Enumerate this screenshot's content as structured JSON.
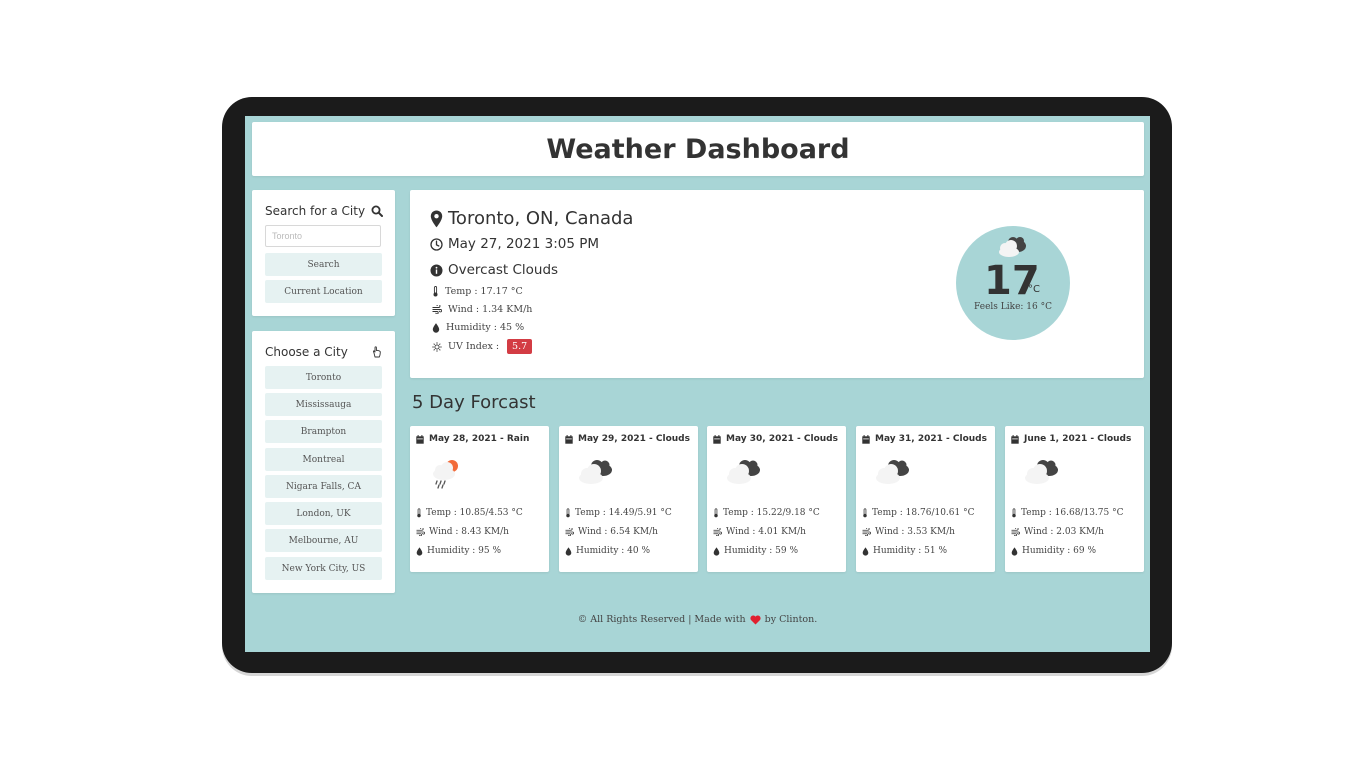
{
  "header": {
    "title": "Weather Dashboard"
  },
  "search": {
    "title": "Search for a City",
    "input_value": "",
    "placeholder": "Toronto",
    "search_label": "Search",
    "current_location_label": "Current Location"
  },
  "cities": {
    "title": "Choose a City",
    "items": [
      "Toronto",
      "Mississauga",
      "Brampton",
      "Montreal",
      "Nigara Falls, CA",
      "London, UK",
      "Melbourne, AU",
      "New York City, US"
    ]
  },
  "current": {
    "location": "Toronto, ON, Canada",
    "datetime": "May 27, 2021 3:05 PM",
    "description": "Overcast Clouds",
    "temp": "Temp : 17.17 °C",
    "wind": "Wind : 1.34 KM/h",
    "humidity": "Humidity : 45 %",
    "uv_label": "UV Index :",
    "uv_value": "5.7",
    "big_temp": "17",
    "unit": "°C",
    "feels_like": "Feels Like: 16 °C",
    "icon": "overcast-clouds-icon"
  },
  "forecast": {
    "title": "5 Day Forcast",
    "days": [
      {
        "date": "May 28, 2021 - Rain",
        "icon": "rain-icon",
        "temp": "Temp : 10.85/4.53 °C",
        "wind": "Wind : 8.43 KM/h",
        "humidity": "Humidity : 95 %"
      },
      {
        "date": "May 29, 2021 - Clouds",
        "icon": "clouds-icon",
        "temp": "Temp : 14.49/5.91 °C",
        "wind": "Wind : 6.54 KM/h",
        "humidity": "Humidity : 40 %"
      },
      {
        "date": "May 30, 2021 - Clouds",
        "icon": "clouds-icon",
        "temp": "Temp : 15.22/9.18 °C",
        "wind": "Wind : 4.01 KM/h",
        "humidity": "Humidity : 59 %"
      },
      {
        "date": "May 31, 2021 - Clouds",
        "icon": "clouds-icon",
        "temp": "Temp : 18.76/10.61 °C",
        "wind": "Wind : 3.53 KM/h",
        "humidity": "Humidity : 51 %"
      },
      {
        "date": "June 1, 2021 - Clouds",
        "icon": "clouds-icon",
        "temp": "Temp : 16.68/13.75 °C",
        "wind": "Wind : 2.03 KM/h",
        "humidity": "Humidity : 69 %"
      }
    ]
  },
  "footer": {
    "text_before": "© All Rights Reserved | Made with",
    "text_after": "by Clinton."
  },
  "colors": {
    "background": "#a8d5d6",
    "button": "#e6f2f2",
    "uv_badge": "#d33c44",
    "heart": "#e0202f",
    "device_frame": "#1b1b1b"
  }
}
